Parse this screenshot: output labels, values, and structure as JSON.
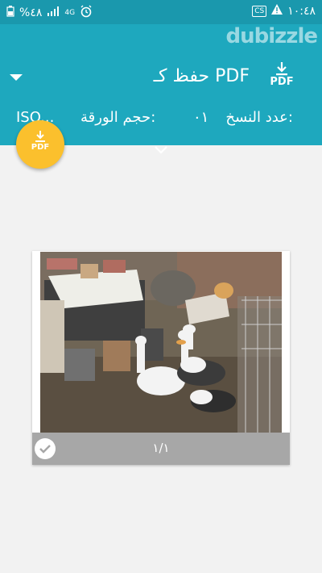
{
  "status": {
    "battery": "%٤٨",
    "network": "4G",
    "time": "١٠:٤٨",
    "cs_badge": "CS"
  },
  "watermark": "dubizzle",
  "header": {
    "title": "حفظ كـ PDF",
    "save_pdf_label": "PDF"
  },
  "options": {
    "copies_label": "عدد النسخ:",
    "copies_value": "٠١",
    "paper_size_label": "حجم الورقة:",
    "paper_size_value": "ISO..."
  },
  "fab": {
    "label": "PDF"
  },
  "preview": {
    "page_counter": "١/١"
  },
  "colors": {
    "statusbar": "#1a98ad",
    "appbar": "#1ea8be",
    "fab": "#fbc02d",
    "footer": "#a7a7a7"
  }
}
